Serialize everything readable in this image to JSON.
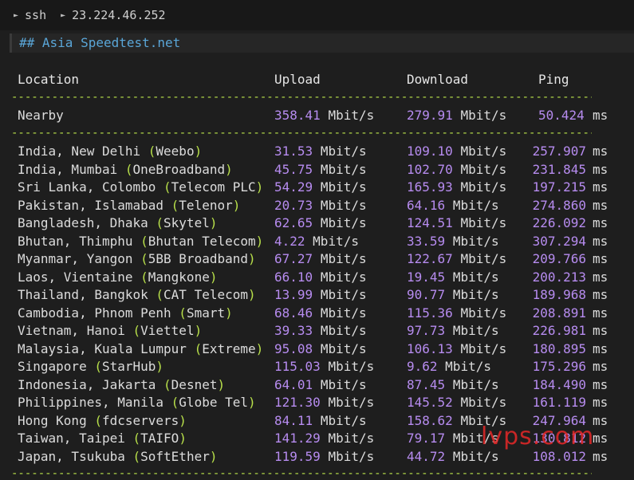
{
  "titlebar": {
    "segments": [
      "ssh",
      "23.224.46.252"
    ]
  },
  "section_title": "## Asia Speedtest.net",
  "columns": {
    "location": "Location",
    "upload": "Upload",
    "download": "Download",
    "ping": "Ping"
  },
  "nearby": {
    "location": "Nearby",
    "upload": "358.41",
    "download": "279.91",
    "ping": "50.424"
  },
  "units": {
    "speed": "Mbit/s",
    "latency": "ms"
  },
  "rows": [
    {
      "place": "India, New Delhi ",
      "isp": "Weebo",
      "upload": "31.53",
      "download": "109.10",
      "ping": "257.907"
    },
    {
      "place": "India, Mumbai ",
      "isp": "OneBroadband",
      "upload": "45.75",
      "download": "102.70",
      "ping": "231.845"
    },
    {
      "place": "Sri Lanka, Colombo ",
      "isp": "Telecom PLC",
      "upload": "54.29",
      "download": "165.93",
      "ping": "197.215"
    },
    {
      "place": "Pakistan, Islamabad ",
      "isp": "Telenor",
      "upload": "20.73",
      "download": "64.16",
      "ping": "274.860"
    },
    {
      "place": "Bangladesh, Dhaka ",
      "isp": "Skytel",
      "upload": "62.65",
      "download": "124.51",
      "ping": "226.092"
    },
    {
      "place": "Bhutan, Thimphu ",
      "isp": "Bhutan Telecom",
      "upload": "4.22",
      "download": "33.59",
      "ping": "307.294"
    },
    {
      "place": "Myanmar, Yangon ",
      "isp": "5BB Broadband",
      "upload": "67.27",
      "download": "122.67",
      "ping": "209.766"
    },
    {
      "place": "Laos, Vientaine ",
      "isp": "Mangkone",
      "upload": "66.10",
      "download": "19.45",
      "ping": "200.213"
    },
    {
      "place": "Thailand, Bangkok ",
      "isp": "CAT Telecom",
      "upload": "13.99",
      "download": "90.77",
      "ping": "189.968"
    },
    {
      "place": "Cambodia, Phnom Penh ",
      "isp": "Smart",
      "upload": "68.46",
      "download": "115.36",
      "ping": "208.891"
    },
    {
      "place": "Vietnam, Hanoi ",
      "isp": "Viettel",
      "upload": "39.33",
      "download": "97.73",
      "ping": "226.981"
    },
    {
      "place": "Malaysia, Kuala Lumpur ",
      "isp": "Extreme",
      "upload": "95.08",
      "download": "106.13",
      "ping": "180.895"
    },
    {
      "place": "Singapore ",
      "isp": "StarHub",
      "upload": "115.03",
      "download": "9.62",
      "ping": "175.296"
    },
    {
      "place": "Indonesia, Jakarta ",
      "isp": "Desnet",
      "upload": "64.01",
      "download": "87.45",
      "ping": "184.490"
    },
    {
      "place": "Philippines, Manila ",
      "isp": "Globe Tel",
      "upload": "121.30",
      "download": "145.52",
      "ping": "161.119"
    },
    {
      "place": "Hong Kong ",
      "isp": "fdcservers",
      "upload": "84.11",
      "download": "158.62",
      "ping": "247.964"
    },
    {
      "place": "Taiwan, Taipei ",
      "isp": "TAIFO",
      "upload": "141.29",
      "download": "79.17",
      "ping": "130.812"
    },
    {
      "place": "Japan, Tsukuba ",
      "isp": "SoftEther",
      "upload": "119.59",
      "download": "44.72",
      "ping": "108.012"
    }
  ],
  "watermark": "lvps.com",
  "colors": {
    "number": "#b78cf0",
    "paren_and_rule": "#b8e04a",
    "heading": "#5aa6d8"
  }
}
